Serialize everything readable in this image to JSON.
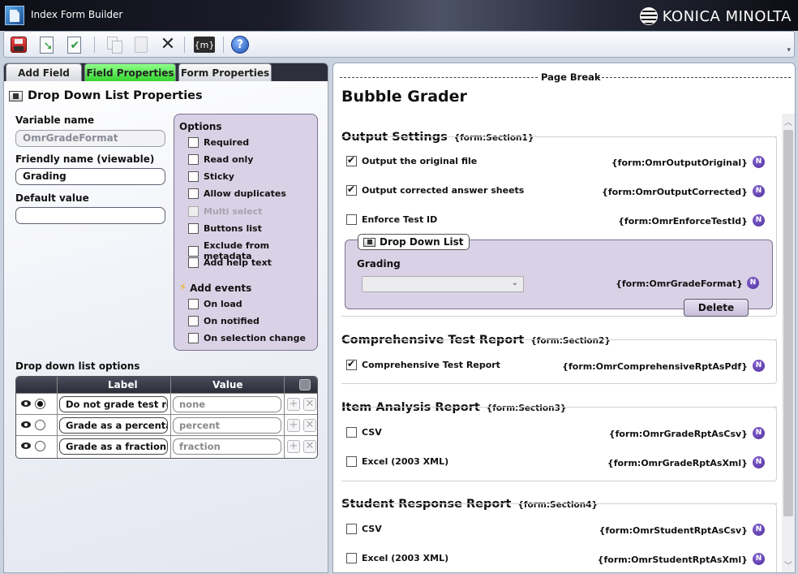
{
  "window": {
    "title": "Index Form Builder",
    "brand": "KONICA MINOLTA"
  },
  "toolbar": {
    "buttons": [
      "save-icon",
      "import-icon",
      "validate-icon",
      "copy-icon",
      "paste-icon",
      "close-icon",
      "variable-icon",
      "help-icon"
    ],
    "variable_label": "{m}",
    "help_label": "?"
  },
  "left": {
    "tabs": [
      "Add Field",
      "Field Properties",
      "Form Properties"
    ],
    "active_tab": "Field Properties",
    "section_title": "Drop Down List Properties",
    "variable_name": {
      "label": "Variable name",
      "value": "OmrGradeFormat"
    },
    "friendly_name": {
      "label": "Friendly name (viewable)",
      "value": "Grading"
    },
    "default_value": {
      "label": "Default value",
      "value": ""
    },
    "options": {
      "title": "Options",
      "items": [
        {
          "label": "Required",
          "checked": false,
          "disabled": false
        },
        {
          "label": "Read only",
          "checked": false,
          "disabled": false
        },
        {
          "label": "Sticky",
          "checked": false,
          "disabled": false
        },
        {
          "label": "Allow duplicates",
          "checked": false,
          "disabled": false
        },
        {
          "label": "Multi select",
          "checked": false,
          "disabled": true
        },
        {
          "label": "Buttons list",
          "checked": false,
          "disabled": false
        },
        {
          "label": "Exclude from metadata",
          "checked": false,
          "disabled": false
        },
        {
          "label": "Add help text",
          "checked": false,
          "disabled": false
        }
      ],
      "events_title": "Add events",
      "events": [
        {
          "label": "On load",
          "checked": false
        },
        {
          "label": "On notified",
          "checked": false
        },
        {
          "label": "On selection change",
          "checked": false
        }
      ]
    },
    "ddl_options": {
      "title": "Drop down list options",
      "columns": [
        "Label",
        "Value"
      ],
      "rows": [
        {
          "label": "Do not grade test res",
          "value": "none",
          "selected": true
        },
        {
          "label": "Grade as a percentag",
          "value": "percent",
          "selected": false
        },
        {
          "label": "Grade as a fraction",
          "value": "fraction",
          "selected": false
        }
      ]
    }
  },
  "right": {
    "page_break": "Page Break",
    "form_title": "Bubble Grader",
    "sections": [
      {
        "title": "Output Settings",
        "tag": "{form:Section1}",
        "rows": [
          {
            "label": "Output the original file",
            "var": "{form:OmrOutputOriginal}",
            "checked": true
          },
          {
            "label": "Output corrected answer sheets",
            "var": "{form:OmrOutputCorrected}",
            "checked": true
          },
          {
            "label": "Enforce Test ID",
            "var": "{form:OmrEnforceTestId}",
            "checked": false
          }
        ],
        "dropdown": {
          "tab_label": "Drop Down List",
          "field_label": "Grading",
          "var": "{form:OmrGradeFormat}",
          "selected": "",
          "delete_label": "Delete"
        }
      },
      {
        "title": "Comprehensive Test Report",
        "tag": "{form:Section2}",
        "rows": [
          {
            "label": "Comprehensive Test Report",
            "var": "{form:OmrComprehensiveRptAsPdf}",
            "checked": true
          }
        ]
      },
      {
        "title": "Item Analysis Report",
        "tag": "{form:Section3}",
        "rows": [
          {
            "label": "CSV",
            "var": "{form:OmrGradeRptAsCsv}",
            "checked": false
          },
          {
            "label": "Excel (2003 XML)",
            "var": "{form:OmrGradeRptAsXml}",
            "checked": false
          }
        ]
      },
      {
        "title": "Student Response Report",
        "tag": "{form:Section4}",
        "rows": [
          {
            "label": "CSV",
            "var": "{form:OmrStudentRptAsCsv}",
            "checked": false
          },
          {
            "label": "Excel (2003 XML)",
            "var": "{form:OmrStudentRptAsXml}",
            "checked": false
          }
        ]
      }
    ],
    "badge_letter": "N"
  },
  "colors": {
    "active_tab": "#35d52f",
    "options_panel": "#d9d2e6",
    "badge": "#4a2a98"
  }
}
